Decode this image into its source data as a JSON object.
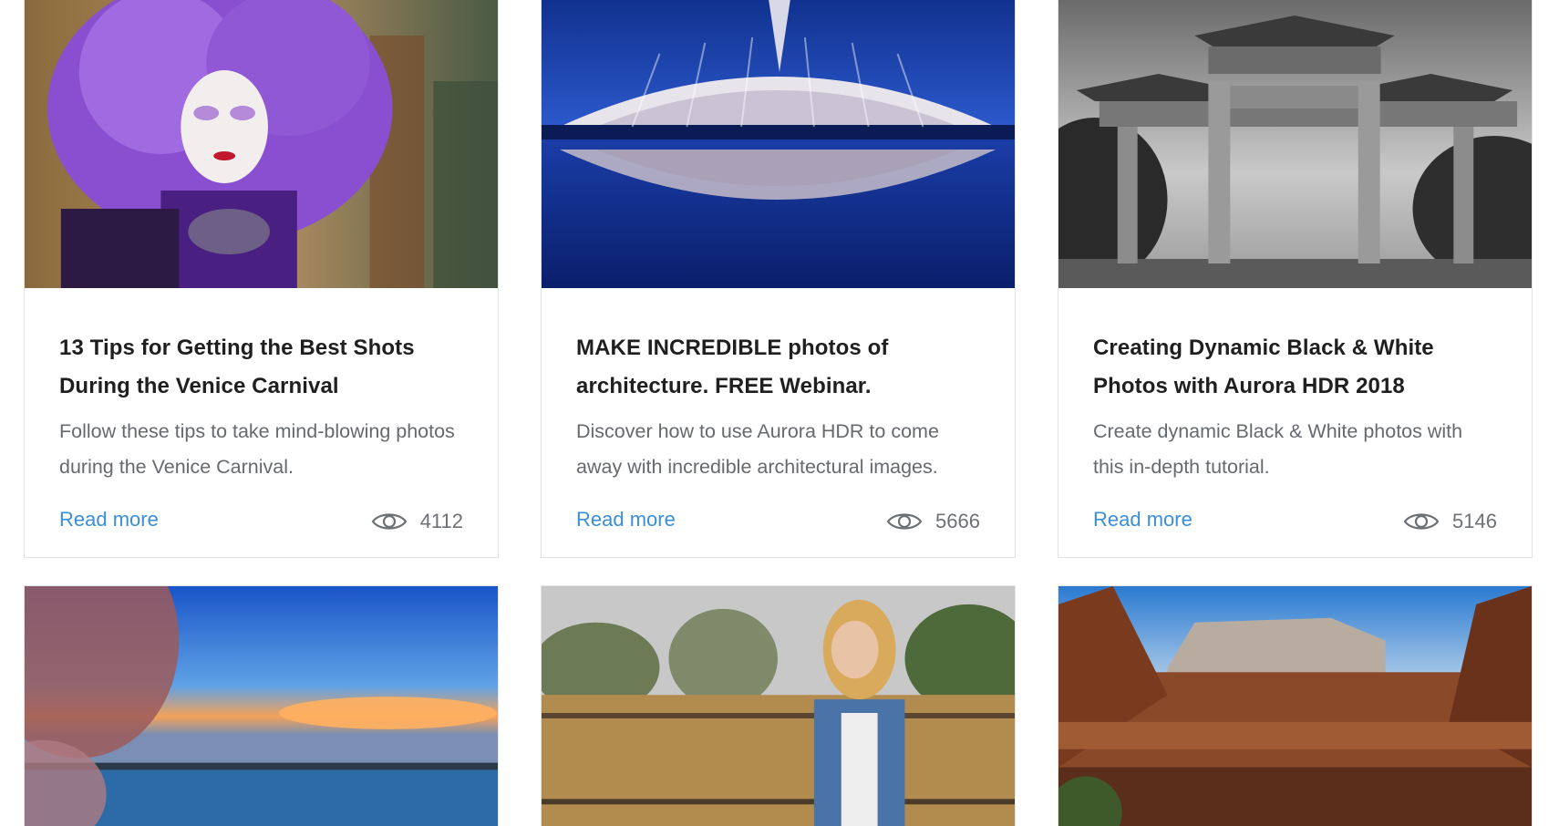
{
  "cards": [
    {
      "title": "13 Tips for Getting the Best Shots During the Venice Carnival",
      "description": "Follow these tips to take mind-blowing photos during the Venice Carnival.",
      "read_more": "Read more",
      "views": "4112"
    },
    {
      "title": "MAKE INCREDIBLE photos of architecture. FREE Webinar.",
      "description": "Discover how to use Aurora HDR to come away with incredible architectural images.",
      "read_more": "Read more",
      "views": "5666"
    },
    {
      "title": "Creating Dynamic Black & White Photos with Aurora HDR 2018",
      "description": "Create dynamic Black & White photos with this in-depth tutorial.",
      "read_more": "Read more",
      "views": "5146"
    }
  ],
  "icons": {
    "views": "eye-icon"
  },
  "colors": {
    "link": "#3a8fd8",
    "title": "#1f1f1f",
    "description": "#666a6e",
    "border": "#e3e3e3"
  }
}
